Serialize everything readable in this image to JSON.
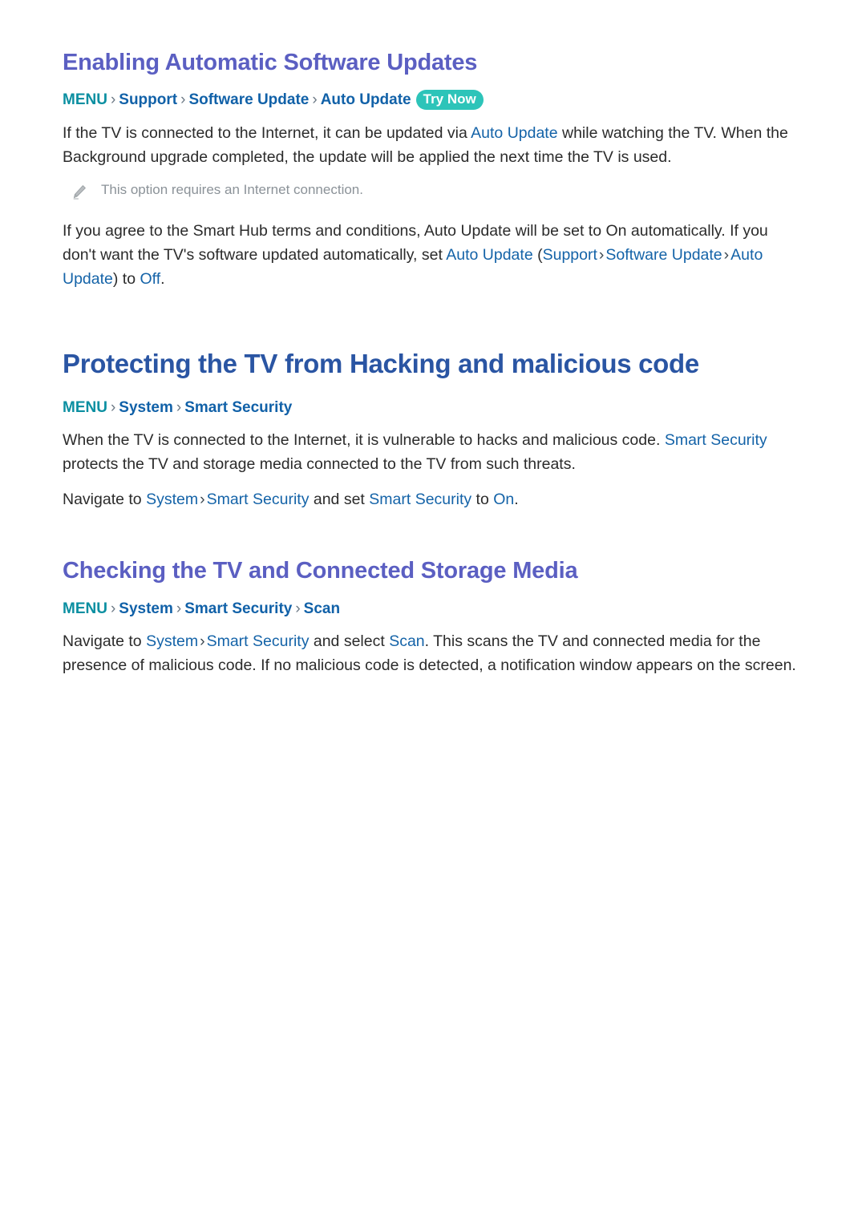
{
  "document": {
    "type": "e-manual-page",
    "background_color": "#ffffff"
  },
  "colors": {
    "h2_heading": "#5b5fc2",
    "h1_heading": "#2a55a3",
    "menu_root": "#0b8fa1",
    "breadcrumb_link": "#1161a8",
    "inline_link": "#1463a8",
    "body_text": "#2b2b2b",
    "note_text": "#8b9298",
    "badge_background": "#2dc4b9",
    "badge_text": "#ffffff"
  },
  "sections": {
    "auto_update": {
      "heading": "Enabling Automatic Software Updates",
      "menu_path": {
        "root": "MENU",
        "separator": "›",
        "crumbs": [
          "Support",
          "Software Update",
          "Auto Update"
        ],
        "badge": "Try Now"
      },
      "paragraph_1": {
        "part_1": "If the TV is connected to the Internet, it can be updated via ",
        "link_1": "Auto Update",
        "part_2": " while watching the TV. When the Background upgrade completed, the update will be applied the next time the TV is used."
      },
      "note": {
        "icon": "pencil-icon",
        "text": "This option requires an Internet connection."
      },
      "paragraph_2": {
        "part_1": "If you agree to the Smart Hub terms and conditions, Auto Update will be set to On automatically. If you don't want the TV's software updated automatically, set ",
        "link_1": "Auto Update",
        "open_paren": " (",
        "link_2": "Support",
        "sep_1": "›",
        "link_3": "Software Update",
        "sep_2": "›",
        "link_4": "Auto Update",
        "close_paren": ")",
        "part_2": " to ",
        "link_5": "Off",
        "part_3": "."
      }
    },
    "smart_security": {
      "heading": "Protecting the TV from Hacking and malicious code",
      "menu_path": {
        "root": "MENU",
        "separator": "›",
        "crumbs": [
          "System",
          "Smart Security"
        ]
      },
      "paragraph_1": {
        "part_1": "When the TV is connected to the Internet, it is vulnerable to hacks and malicious code. ",
        "link_1": "Smart Security",
        "part_2": " protects the TV and storage media connected to the TV from such threats."
      },
      "paragraph_2": {
        "part_1": "Navigate to ",
        "link_1": "System",
        "sep_1": "›",
        "link_2": "Smart Security",
        "part_2": " and set ",
        "link_3": "Smart Security",
        "part_3": " to ",
        "link_4": "On",
        "part_4": "."
      }
    },
    "scan": {
      "heading": "Checking the TV and Connected Storage Media",
      "menu_path": {
        "root": "MENU",
        "separator": "›",
        "crumbs": [
          "System",
          "Smart Security",
          "Scan"
        ]
      },
      "paragraph_1": {
        "part_1": "Navigate to ",
        "link_1": "System",
        "sep_1": "›",
        "link_2": "Smart Security",
        "part_2": " and select ",
        "link_3": "Scan",
        "part_3": ". This scans the TV and connected media for the presence of malicious code. If no malicious code is detected, a notification window appears on the screen."
      }
    }
  }
}
